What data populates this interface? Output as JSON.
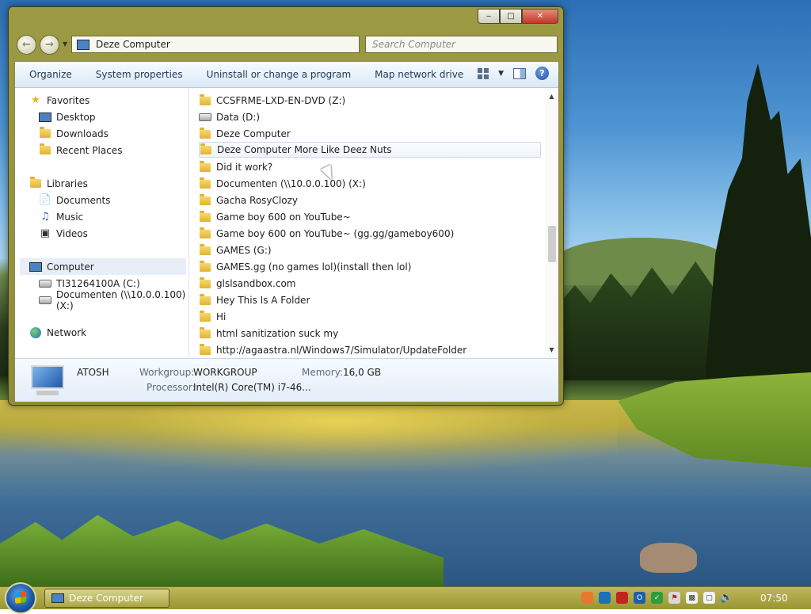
{
  "window": {
    "title": "Deze Computer",
    "address": "Deze Computer",
    "search_placeholder": "Search Computer",
    "caption_buttons": {
      "minimize": "‒",
      "maximize": "□",
      "close": "✕"
    }
  },
  "toolbar": {
    "organize": "Organize",
    "system_properties": "System properties",
    "uninstall": "Uninstall or change a program",
    "map_drive": "Map network drive"
  },
  "nav": {
    "favorites": "Favorites",
    "desktop": "Desktop",
    "downloads": "Downloads",
    "recent_places": "Recent Places",
    "libraries": "Libraries",
    "documents": "Documents",
    "music": "Music",
    "videos": "Videos",
    "computer": "Computer",
    "drive_c": "TI31264100A (C:)",
    "drive_x": "Documenten (\\\\10.0.0.100) (X:)",
    "network": "Network"
  },
  "files": [
    "CCSFRME-LXD-EN-DVD (Z:)",
    "Data (D:)",
    "Deze Computer",
    "Deze Computer More Like Deez Nuts",
    "Did it work?",
    "Documenten (\\\\10.0.0.100) (X:)",
    "Gacha RosyClozy",
    "Game boy 600 on YouTube~",
    "Game boy 600 on YouTube~ (gg.gg/gameboy600)",
    "GAMES (G:)",
    "GAMES.gg (no games lol)(install then lol)",
    "glslsandbox.com",
    "Hey This Is A Folder",
    "Hi",
    "html sanitization suck my",
    "http://agaastra.nl/Windows7/Simulator/UpdateFolder"
  ],
  "details": {
    "computer_name": "ATOSH",
    "workgroup_label": "Workgroup:",
    "workgroup_value": "WORKGROUP",
    "memory_label": "Memory:",
    "memory_value": "16,0 GB",
    "processor_label": "Processor:",
    "processor_value": "Intel(R) Core(TM) i7-46..."
  },
  "taskbar": {
    "window_button": "Deze Computer",
    "clock": "07:50"
  }
}
